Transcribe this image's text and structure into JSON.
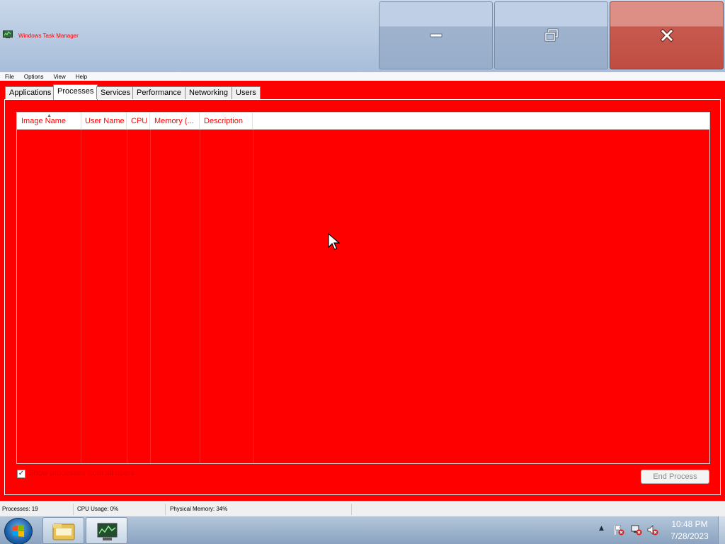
{
  "window": {
    "title": "Windows Task Manager"
  },
  "menu": [
    "File",
    "Options",
    "View",
    "Help"
  ],
  "tabs": [
    "Applications",
    "Processes",
    "Services",
    "Performance",
    "Networking",
    "Users"
  ],
  "active_tab": "Processes",
  "columns": [
    "Image Name",
    "User Name",
    "CPU",
    "Memory (...",
    "Description"
  ],
  "sort_column": "Image Name",
  "show_all_processes": {
    "label": "Show processes from all users",
    "checked": true
  },
  "end_process_label": "End Process",
  "status": {
    "processes": "Processes: 19",
    "cpu": "CPU Usage: 0%",
    "memory": "Physical Memory: 34%"
  },
  "clock": {
    "time": "10:48 PM",
    "date": "7/28/2023"
  },
  "colors": {
    "background": "#ff0000",
    "accent_text": "#ff0000",
    "close_button": "#c75a4f"
  },
  "icons": [
    "task-manager-app-icon",
    "minimize-icon",
    "restore-icon",
    "close-icon",
    "windows-start-icon",
    "explorer-folder-icon",
    "task-manager-taskbar-icon",
    "tray-expand-icon",
    "action-center-flag-icon",
    "network-icon",
    "volume-muted-icon",
    "mouse-cursor"
  ]
}
